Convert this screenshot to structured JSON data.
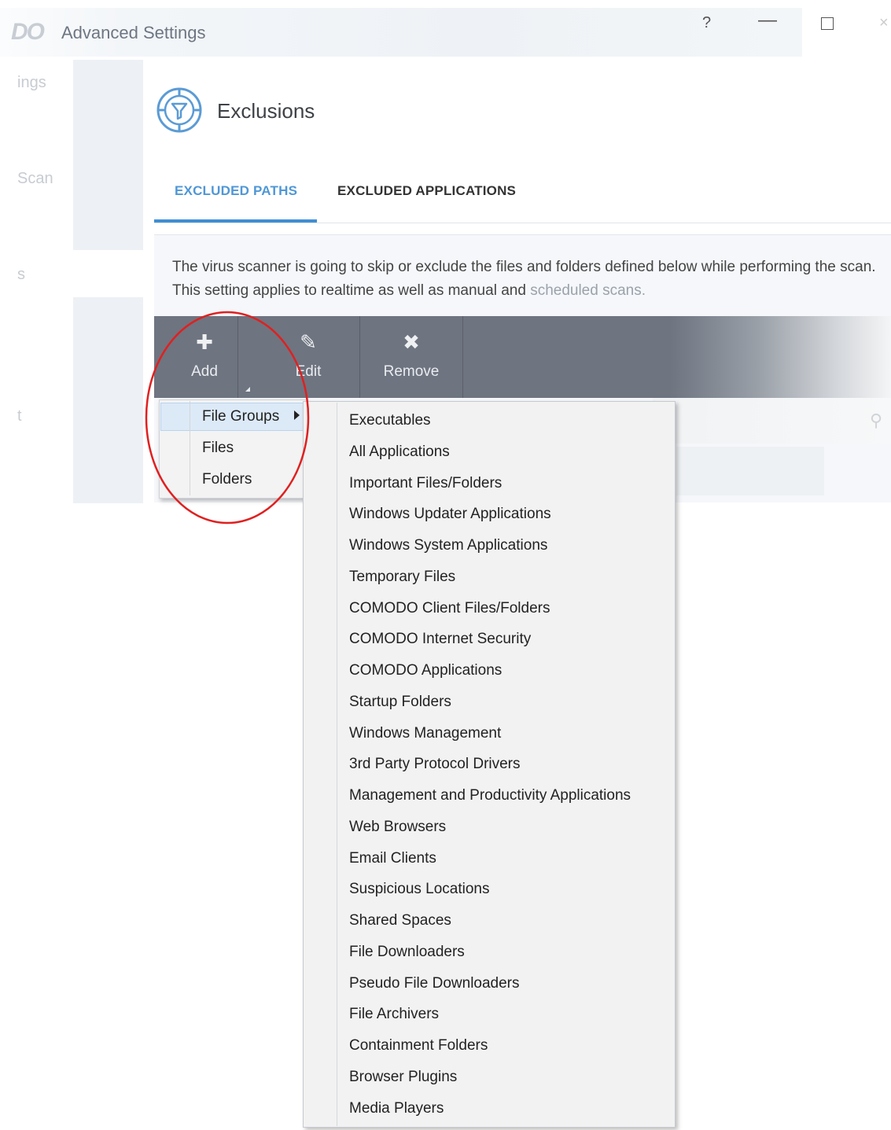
{
  "window": {
    "logo_text": "DO",
    "title": "Advanced Settings",
    "help_label": "?",
    "minimize_label": "—",
    "close_label": "×"
  },
  "left_nav": {
    "items": [
      "ings",
      "Scan",
      "s",
      "t"
    ]
  },
  "page": {
    "title": "Exclusions",
    "tabs": [
      {
        "label": "EXCLUDED PATHS",
        "active": true
      },
      {
        "label": "EXCLUDED APPLICATIONS",
        "active": false
      }
    ],
    "description_main": "The virus scanner is going to skip or exclude the files and folders defined below while performing the scan. This setting applies to realtime as well as manual and",
    "description_tail": "scheduled scans."
  },
  "toolbar": {
    "add_label": "Add",
    "edit_label": "Edit",
    "remove_label": "Remove",
    "add_icon": "plus-icon",
    "edit_icon": "pencil-icon",
    "remove_icon": "x-icon"
  },
  "add_menu": {
    "items": [
      "File Groups",
      "Files",
      "Folders"
    ],
    "highlighted": "File Groups"
  },
  "file_groups_menu": {
    "items": [
      "Executables",
      "All Applications",
      "Important Files/Folders",
      "Windows Updater Applications",
      "Windows System Applications",
      "Temporary Files",
      "COMODO Client Files/Folders",
      "COMODO Internet Security",
      "COMODO Applications",
      "Startup Folders",
      "Windows Management",
      "3rd Party Protocol Drivers",
      "Management and Productivity Applications",
      "Web Browsers",
      "Email Clients",
      "Suspicious Locations",
      "Shared Spaces",
      "File Downloaders",
      "Pseudo File Downloaders",
      "File Archivers",
      "Containment Folders",
      "Browser Plugins",
      "Media Players"
    ]
  },
  "colors": {
    "accent": "#3f8ed4",
    "toolbar": "#6e7480",
    "annotation": "#e02020"
  }
}
